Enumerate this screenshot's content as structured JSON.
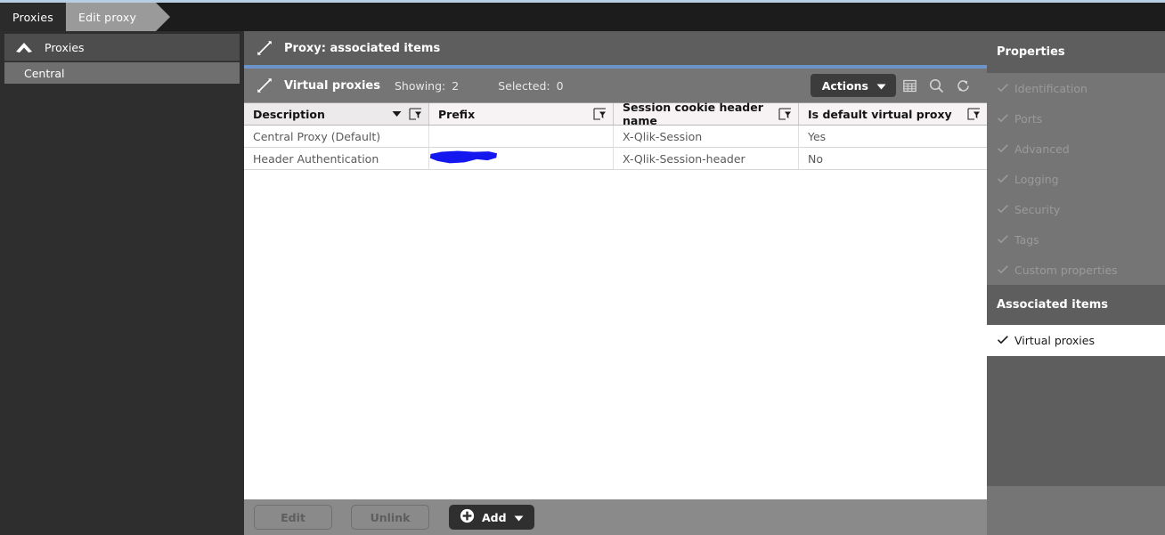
{
  "colors": {
    "accent_blue": "#6d94c8",
    "top_line": "#b7cee4",
    "redaction": "#1517ef",
    "panel_gray": "#757575",
    "panel_dark": "#5e5e5e",
    "sidebar_dark": "#2e2e2e"
  },
  "tabs": [
    {
      "label": "Proxies",
      "active": false
    },
    {
      "label": "Edit proxy",
      "active": true
    }
  ],
  "sidebar": {
    "header": {
      "label": "Proxies",
      "icon": "chevron-up-icon"
    },
    "items": [
      {
        "label": "Central",
        "selected": true
      }
    ]
  },
  "main": {
    "title": "Proxy: associated items",
    "title_icon": "collapse-arrows-icon",
    "toolbar": {
      "icon": "collapse-arrows-icon",
      "title": "Virtual proxies",
      "showing_label": "Showing:",
      "showing_value": "2",
      "selected_label": "Selected:",
      "selected_value": "0",
      "actions_label": "Actions",
      "icons": [
        "table-columns-icon",
        "search-icon",
        "refresh-icon"
      ]
    },
    "table": {
      "columns": [
        {
          "header": "Description",
          "sorted": true,
          "filter_icon": "filter-icon"
        },
        {
          "header": "Prefix",
          "sorted": false,
          "filter_icon": "filter-icon"
        },
        {
          "header": "Session cookie header name",
          "sorted": false,
          "filter_icon": "filter-icon"
        },
        {
          "header": "Is default virtual proxy",
          "sorted": false,
          "filter_icon": "filter-icon"
        }
      ],
      "rows": [
        {
          "description": "Central Proxy (Default)",
          "prefix": "",
          "prefix_redacted": false,
          "session_cookie_header_name": "X-Qlik-Session",
          "is_default_virtual_proxy": "Yes"
        },
        {
          "description": "Header Authentication",
          "prefix": "",
          "prefix_redacted": true,
          "session_cookie_header_name": "X-Qlik-Session-header",
          "is_default_virtual_proxy": "No"
        }
      ]
    },
    "footer": {
      "edit_label": "Edit",
      "unlink_label": "Unlink",
      "add_label": "Add",
      "add_icon": "plus-circle-icon"
    }
  },
  "properties_panel": {
    "header": "Properties",
    "items": [
      {
        "label": "Identification",
        "checked": true
      },
      {
        "label": "Ports",
        "checked": true
      },
      {
        "label": "Advanced",
        "checked": true
      },
      {
        "label": "Logging",
        "checked": true
      },
      {
        "label": "Security",
        "checked": true
      },
      {
        "label": "Tags",
        "checked": true
      },
      {
        "label": "Custom properties",
        "checked": true
      }
    ],
    "associated_header": "Associated items",
    "associated_items": [
      {
        "label": "Virtual proxies",
        "checked": true,
        "active": true
      }
    ]
  }
}
